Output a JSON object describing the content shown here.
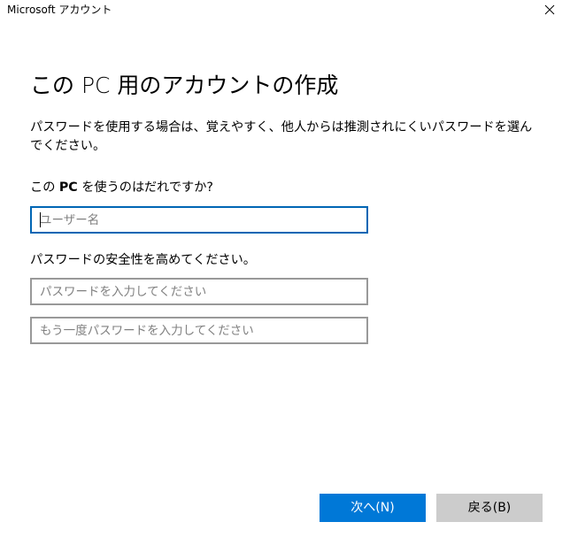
{
  "window": {
    "title": "Microsoft アカウント"
  },
  "page": {
    "heading": "この PC 用のアカウントの作成",
    "description": "パスワードを使用する場合は、覚えやすく、他人からは推測されにくいパスワードを選んでください。"
  },
  "username_section": {
    "label_prefix": "この ",
    "label_bold": "PC",
    "label_suffix": " を使うのはだれですか?",
    "username_placeholder": "ユーザー名"
  },
  "password_section": {
    "label": "パスワードの安全性を高めてください。",
    "password_placeholder": "パスワードを入力してください",
    "confirm_placeholder": "もう一度パスワードを入力してください"
  },
  "buttons": {
    "next_label": "次へ(N)",
    "back_label": "戻る(B)"
  },
  "colors": {
    "primary_button": "#0078d7",
    "secondary_button": "#cccccc",
    "focused_border": "#0066b4",
    "input_border": "#999999"
  },
  "icons": {
    "close": "close-icon"
  }
}
